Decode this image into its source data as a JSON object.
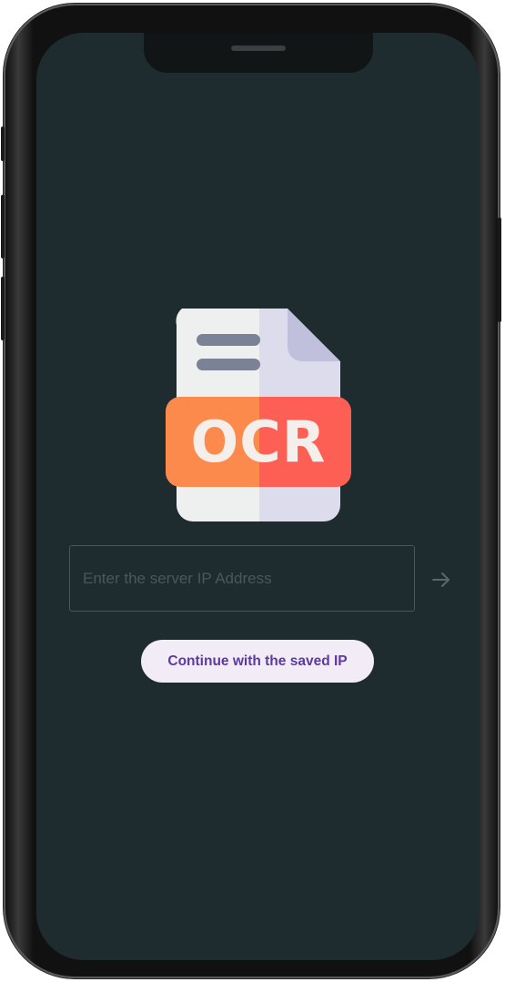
{
  "logo": {
    "text": "OCR",
    "colors": {
      "page_left": "#eef0f0",
      "page_right": "#dcdcec",
      "fold": "#c0c0dd",
      "lines": "#7c8295",
      "band_left": "#fd8a4d",
      "band_right": "#fd5f55",
      "text": "#f4efea"
    }
  },
  "server_ip": {
    "placeholder": "Enter the server IP Address",
    "value": ""
  },
  "submit": {
    "icon": "arrow-right-icon"
  },
  "saved_ip_button": {
    "label": "Continue with the saved IP"
  },
  "theme": {
    "screen_background": "#1e2b2f",
    "button_background": "#f1ecf6",
    "button_text": "#5c3aa0"
  }
}
